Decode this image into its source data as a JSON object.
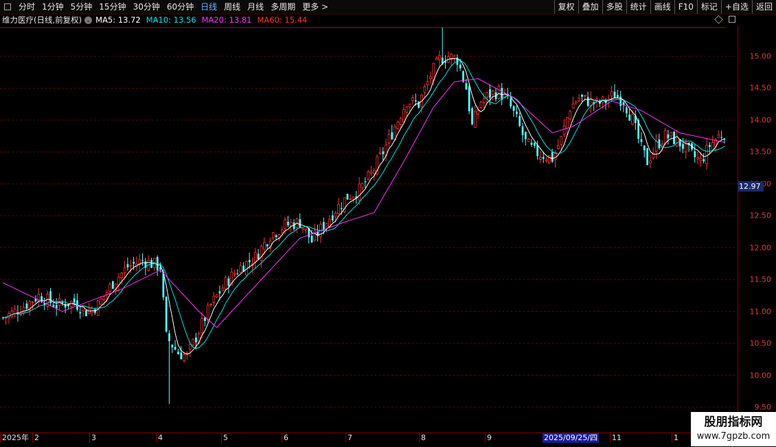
{
  "toolbar": {
    "periods": [
      "分时",
      "1分钟",
      "5分钟",
      "15分钟",
      "30分钟",
      "60分钟",
      "日线",
      "周线",
      "月线",
      "多周期",
      "更多 >"
    ],
    "active_period": "日线",
    "right_buttons": [
      "复权",
      "叠加",
      "多股",
      "统计",
      "画线",
      "F10",
      "标记",
      "+自选",
      "返回"
    ]
  },
  "info": {
    "stock": "维力医疗(日线,前复权)",
    "ma5": "MA5: 13.72",
    "ma10": "MA10: 13.56",
    "ma20": "MA20: 13.81",
    "ma60": "MA60: 15.44"
  },
  "colors": {
    "up": "#ff3333",
    "down": "#54ffff",
    "ma5": "#ffffff",
    "ma10": "#00e5e5",
    "ma20": "#ff33ff",
    "ma60": "#ff3333",
    "axis": "#e03a3a",
    "grid": "#7a0000"
  },
  "price_axis": {
    "ticks": [
      "15.00",
      "14.50",
      "14.00",
      "13.50",
      "13.00",
      "12.50",
      "12.00",
      "11.50",
      "11.00",
      "10.50",
      "10.00",
      "9.50"
    ],
    "min": 9.5,
    "max": 15.5,
    "current": "12.97"
  },
  "date_axis": {
    "labels": [
      "2025年",
      "2",
      "3",
      "4",
      "5",
      "6",
      "7",
      "8",
      "9",
      "11",
      "1"
    ],
    "cursor_date": "2025/09/25/四"
  },
  "chart_data": {
    "type": "candlestick",
    "ylim": [
      9.5,
      15.5
    ],
    "keypoints_close": [
      [
        0,
        10.9
      ],
      [
        6,
        11.05
      ],
      [
        12,
        11.25
      ],
      [
        18,
        11.1
      ],
      [
        24,
        11.15
      ],
      [
        28,
        11.0
      ],
      [
        32,
        11.1
      ],
      [
        37,
        11.45
      ],
      [
        42,
        11.7
      ],
      [
        47,
        11.8
      ],
      [
        50,
        11.75
      ],
      [
        53,
        11.7
      ],
      [
        55,
        10.6
      ],
      [
        59,
        10.35
      ],
      [
        62,
        10.3
      ],
      [
        66,
        10.7
      ],
      [
        70,
        11.1
      ],
      [
        75,
        11.45
      ],
      [
        80,
        11.7
      ],
      [
        85,
        11.85
      ],
      [
        90,
        12.2
      ],
      [
        95,
        12.35
      ],
      [
        100,
        12.4
      ],
      [
        104,
        12.1
      ],
      [
        108,
        12.35
      ],
      [
        112,
        12.6
      ],
      [
        116,
        12.8
      ],
      [
        120,
        12.9
      ],
      [
        124,
        13.15
      ],
      [
        128,
        13.5
      ],
      [
        132,
        13.9
      ],
      [
        136,
        14.3
      ],
      [
        140,
        14.25
      ],
      [
        144,
        14.7
      ],
      [
        147,
        14.95
      ],
      [
        150,
        15.0
      ],
      [
        153,
        14.95
      ],
      [
        156,
        14.5
      ],
      [
        158,
        13.9
      ],
      [
        161,
        14.3
      ],
      [
        164,
        14.4
      ],
      [
        167,
        14.45
      ],
      [
        170,
        14.3
      ],
      [
        173,
        14.0
      ],
      [
        176,
        13.65
      ],
      [
        179,
        13.5
      ],
      [
        182,
        13.45
      ],
      [
        185,
        13.4
      ],
      [
        188,
        13.7
      ],
      [
        191,
        14.2
      ],
      [
        194,
        14.35
      ],
      [
        197,
        14.3
      ],
      [
        200,
        14.25
      ],
      [
        203,
        14.3
      ],
      [
        206,
        14.4
      ],
      [
        209,
        14.3
      ],
      [
        212,
        14.0
      ],
      [
        215,
        13.55
      ],
      [
        217,
        13.35
      ],
      [
        220,
        13.6
      ],
      [
        223,
        13.75
      ],
      [
        226,
        13.7
      ],
      [
        229,
        13.6
      ],
      [
        232,
        13.45
      ],
      [
        235,
        13.35
      ],
      [
        238,
        13.6
      ],
      [
        241,
        13.75
      ],
      [
        243,
        13.8
      ]
    ],
    "ma60_path": [
      [
        0,
        11.45
      ],
      [
        20,
        11.0
      ],
      [
        40,
        11.35
      ],
      [
        53,
        11.65
      ],
      [
        66,
        11.0
      ],
      [
        72,
        10.75
      ],
      [
        85,
        11.4
      ],
      [
        100,
        12.15
      ],
      [
        115,
        12.4
      ],
      [
        125,
        12.55
      ],
      [
        135,
        13.35
      ],
      [
        145,
        14.2
      ],
      [
        152,
        14.6
      ],
      [
        160,
        14.65
      ],
      [
        172,
        14.35
      ],
      [
        185,
        13.8
      ],
      [
        192,
        13.9
      ],
      [
        205,
        14.3
      ],
      [
        215,
        14.15
      ],
      [
        228,
        13.8
      ],
      [
        243,
        13.65
      ]
    ]
  },
  "watermark": {
    "line1": "股朋指标网",
    "line2": "www.7gpzb.com"
  }
}
